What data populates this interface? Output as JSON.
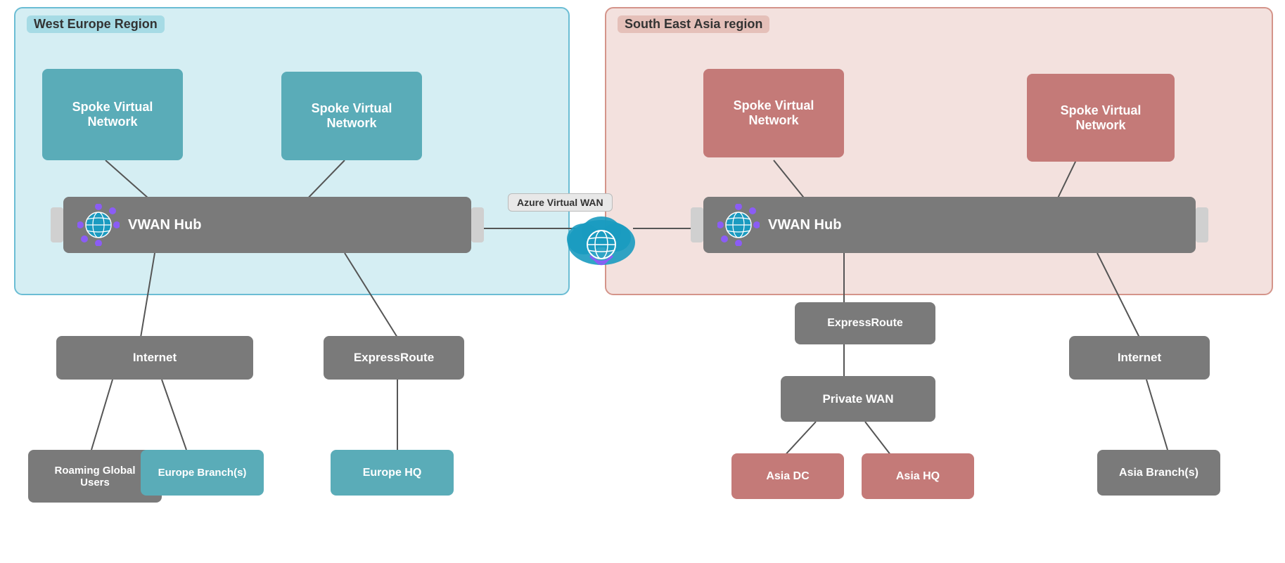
{
  "regions": {
    "west": {
      "label": "West Europe Region"
    },
    "sea": {
      "label": "South East Asia region"
    }
  },
  "azure_wan": {
    "label": "Azure Virtual WAN"
  },
  "west_elements": {
    "spoke1": "Spoke Virtual\nNetwork",
    "spoke2": "Spoke Virtual\nNetwork",
    "vwan_hub": "VWAN Hub",
    "internet": "Internet",
    "express_route": "ExpressRoute",
    "roaming": "Roaming Global\nUsers",
    "europe_branch": "Europe Branch(s)",
    "europe_hq": "Europe HQ"
  },
  "sea_elements": {
    "spoke1": "Spoke Virtual\nNetwork",
    "spoke2": "Spoke Virtual\nNetwork",
    "vwan_hub": "VWAN Hub",
    "express_route_top": "ExpressRoute",
    "private_wan": "Private WAN",
    "internet": "Internet",
    "asia_dc": "Asia DC",
    "asia_hq": "Asia HQ",
    "asia_branch": "Asia Branch(s)"
  }
}
